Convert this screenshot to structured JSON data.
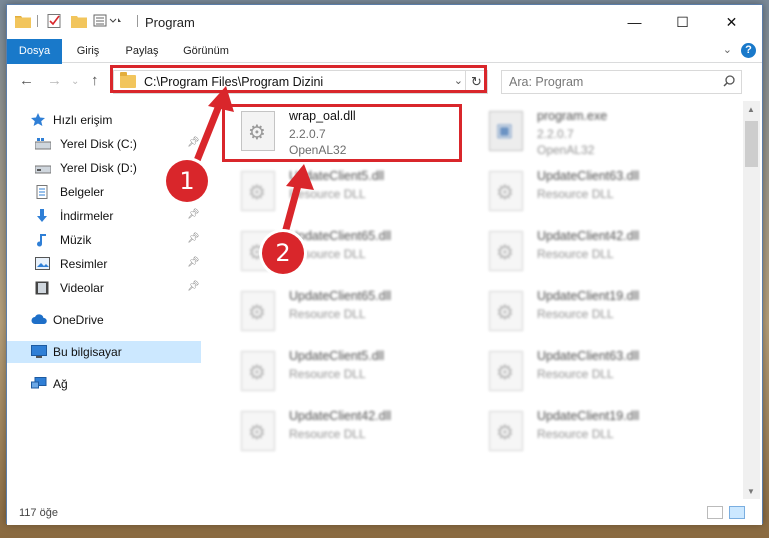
{
  "window": {
    "title": "Program"
  },
  "ribbon": {
    "tabs": [
      "Dosya",
      "Giriş",
      "Paylaş",
      "Görünüm"
    ],
    "expand_icon": "chevron-down-icon",
    "help_label": "?"
  },
  "nav": {
    "address": "C:\\Program Files\\Program Dizini",
    "search_placeholder": "Ara: Program",
    "refresh_glyph": "↻",
    "dropdown_glyph": "⌄"
  },
  "sidebar": {
    "quick_access": "Hızlı erişim",
    "items": [
      {
        "label": "Yerel Disk (C:)",
        "icon": "drive-icon",
        "pinned": true
      },
      {
        "label": "Yerel Disk (D:)",
        "icon": "drive-icon",
        "pinned": false
      },
      {
        "label": "Belgeler",
        "icon": "documents-icon",
        "pinned": true
      },
      {
        "label": "İndirmeler",
        "icon": "download-icon",
        "pinned": true
      },
      {
        "label": "Müzik",
        "icon": "music-icon",
        "pinned": true
      },
      {
        "label": "Resimler",
        "icon": "pictures-icon",
        "pinned": true
      },
      {
        "label": "Videolar",
        "icon": "videos-icon",
        "pinned": true
      }
    ],
    "onedrive": "OneDrive",
    "this_pc": "Bu bilgisayar",
    "network": "Ağ"
  },
  "files": [
    {
      "name": "wrap_oal.dll",
      "line2": "2.2.0.7",
      "line3": "OpenAL32",
      "icon": "dll-gear-icon",
      "highlighted": true
    },
    {
      "name": "program.exe",
      "line2": "2.2.0.7",
      "line3": "OpenAL32",
      "icon": "exe-icon",
      "blurred": true
    },
    {
      "name": "UpdateClient5.dll",
      "line2": "Resource DLL",
      "blurred": true
    },
    {
      "name": "UpdateClient63.dll",
      "line2": "Resource DLL",
      "blurred": true
    },
    {
      "name": "UpdateClient65.dll",
      "line2": "Resource DLL",
      "blurred": true
    },
    {
      "name": "UpdateClient42.dll",
      "line2": "Resource DLL",
      "blurred": true
    },
    {
      "name": "UpdateClient65.dll",
      "line2": "Resource DLL",
      "blurred": true
    },
    {
      "name": "UpdateClient19.dll",
      "line2": "Resource DLL",
      "blurred": true
    },
    {
      "name": "UpdateClient5.dll",
      "line2": "Resource DLL",
      "blurred": true
    },
    {
      "name": "UpdateClient63.dll",
      "line2": "Resource DLL",
      "blurred": true
    },
    {
      "name": "UpdateClient42.dll",
      "line2": "Resource DLL",
      "blurred": true
    },
    {
      "name": "UpdateClient19.dll",
      "line2": "Resource DLL",
      "blurred": true
    }
  ],
  "status": {
    "count": "117 öğe"
  },
  "callouts": {
    "one": "1",
    "two": "2",
    "color": "#d9262b"
  }
}
